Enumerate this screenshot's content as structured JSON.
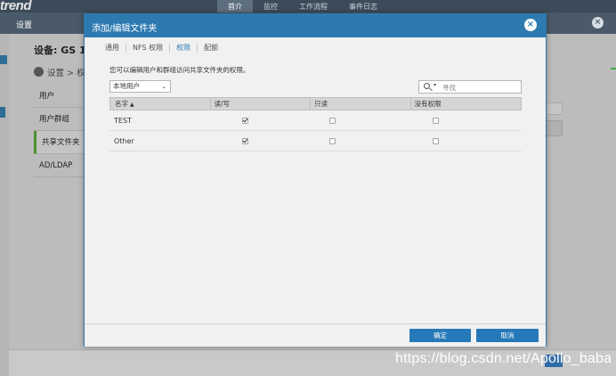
{
  "app": {
    "logo": "trend",
    "nav": [
      "首介",
      "监控",
      "工作流程",
      "事件日志"
    ],
    "window_title": "设置",
    "device_label": "设备: GS 1(",
    "breadcrumb": "设置 > 权",
    "sidebar": [
      "用户",
      "用户群组",
      "共享文件夹",
      "AD/LDAP"
    ],
    "watermark": "https://blog.csdn.net/Apollo_baba"
  },
  "dialog": {
    "title": "添加/编辑文件夹",
    "close_icon": "×",
    "tabs": [
      {
        "label": "通用"
      },
      {
        "label": "NFS 权限"
      },
      {
        "label": "权限",
        "active": true
      },
      {
        "label": "配额"
      }
    ],
    "description": "您可以编辑用户和群组访问共享文件夹的权限。",
    "filter": {
      "selected": "本地用户",
      "caret": "⌄"
    },
    "search": {
      "placeholder": "寻找",
      "dropdown": "▾"
    },
    "table": {
      "headers": [
        "名字",
        "读/写",
        "只读",
        "没有权限"
      ],
      "sort_indicator": "▲",
      "rows": [
        {
          "name": "TEST",
          "read_write": true,
          "read_only": false,
          "no_access": false
        },
        {
          "name": "Other",
          "read_write": true,
          "read_only": false,
          "no_access": false
        }
      ]
    },
    "buttons": {
      "ok": "确定",
      "cancel": "取消"
    }
  },
  "colors": {
    "header_blue": "#2d7ab1",
    "button_blue": "#2679b8",
    "selection_green": "#4e8f2f"
  }
}
